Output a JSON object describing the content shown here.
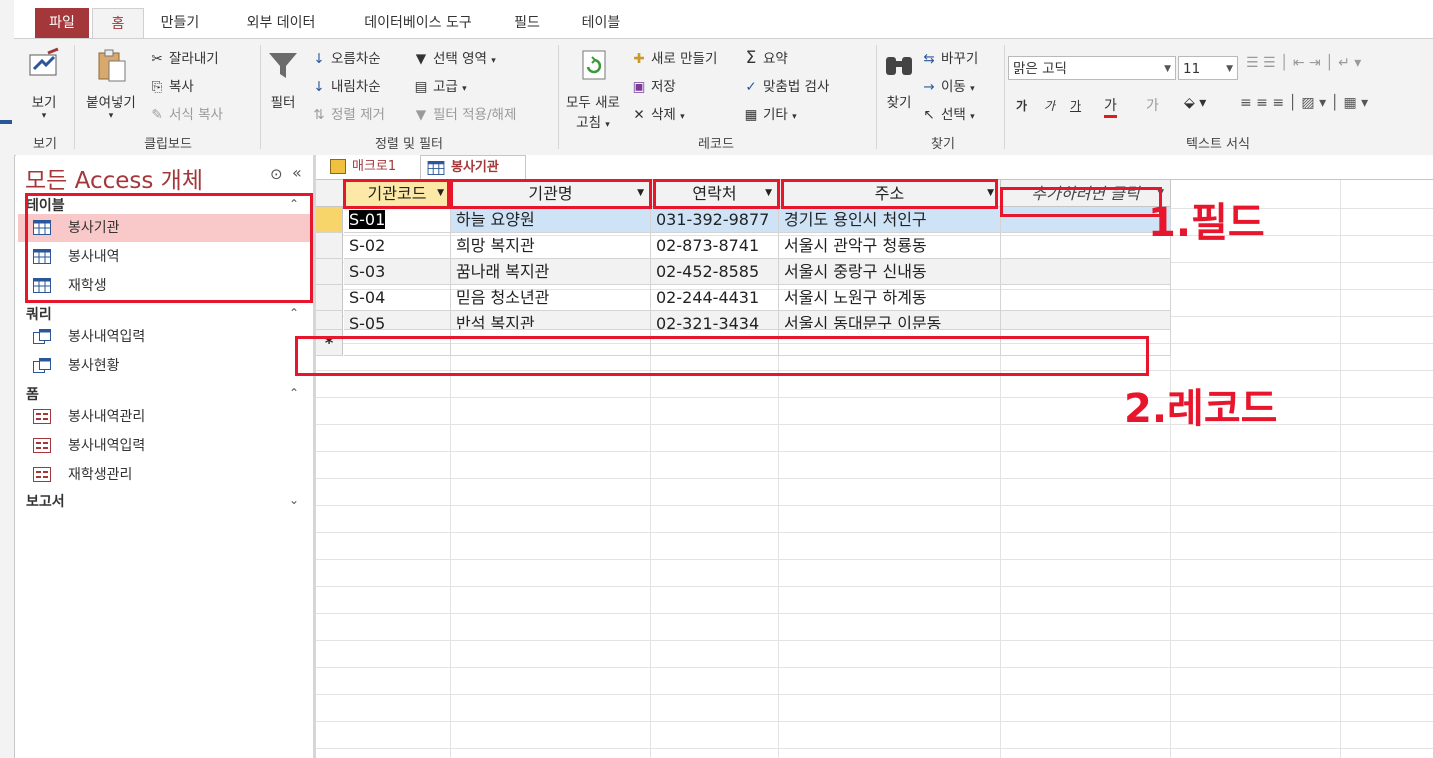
{
  "ribbon_tabs": [
    "파일",
    "홈",
    "만들기",
    "외부 데이터",
    "데이터베이스 도구",
    "필드",
    "테이블"
  ],
  "ribbon": {
    "view": {
      "label": "보기",
      "group": "보기"
    },
    "clipboard": {
      "paste": "붙여넣기",
      "cut": "잘라내기",
      "copy": "복사",
      "format_painter": "서식 복사",
      "group": "클립보드"
    },
    "sort_filter": {
      "filter": "필터",
      "ascending": "오름차순",
      "descending": "내림차순",
      "remove_sort": "정렬 제거",
      "selection": "선택 영역",
      "advanced": "고급",
      "toggle_filter": "필터 적용/해제",
      "group": "정렬 및 필터"
    },
    "records": {
      "refresh_all_1": "모두 새로",
      "refresh_all_2": "고침",
      "new": "새로 만들기",
      "save": "저장",
      "delete": "삭제",
      "totals": "요약",
      "spelling": "맞춤법 검사",
      "more": "기타",
      "group": "레코드"
    },
    "find": {
      "find": "찾기",
      "replace": "바꾸기",
      "goto": "이동",
      "select": "선택",
      "group": "찾기"
    },
    "text_format": {
      "font": "맑은 고딕",
      "size": "11",
      "bold": "가",
      "italic": "가",
      "underline": "가",
      "font_color": "가",
      "highlight": "가",
      "group": "텍스트 서식"
    }
  },
  "nav": {
    "title": "모든 Access 개체",
    "sections": [
      {
        "header": "테이블",
        "items": [
          "봉사기관",
          "봉사내역",
          "재학생"
        ]
      },
      {
        "header": "쿼리",
        "items": [
          "봉사내역입력",
          "봉사현황"
        ]
      },
      {
        "header": "폼",
        "items": [
          "봉사내역관리",
          "봉사내역입력",
          "재학생관리"
        ]
      },
      {
        "header": "보고서",
        "items": []
      }
    ],
    "selected": "봉사기관"
  },
  "doc_tabs": [
    "매크로1",
    "봉사기관"
  ],
  "table": {
    "columns": [
      "기관코드",
      "기관명",
      "연락처",
      "주소",
      "추가하려면 클릭"
    ],
    "rows": [
      [
        "S-01",
        "하늘 요양원",
        "031-392-9877",
        "경기도 용인시 처인구"
      ],
      [
        "S-02",
        "희망 복지관",
        "02-873-8741",
        "서울시 관악구 청룡동"
      ],
      [
        "S-03",
        "꿈나래 복지관",
        "02-452-8585",
        "서울시 중랑구 신내동"
      ],
      [
        "S-04",
        "믿음 청소년관",
        "02-244-4431",
        "서울시 노원구 하계동"
      ],
      [
        "S-05",
        "반석 복지관",
        "02-321-3434",
        "서울시 동대문구 이문동"
      ]
    ],
    "new_record_marker": "*"
  },
  "annotations": {
    "field": "1.필드",
    "record": "2.레코드"
  },
  "colors": {
    "access_accent": "#a4373a",
    "annotation_red": "#e8162d",
    "selected_row": "#cfe3f7",
    "nav_selected": "#f9c8c8"
  }
}
